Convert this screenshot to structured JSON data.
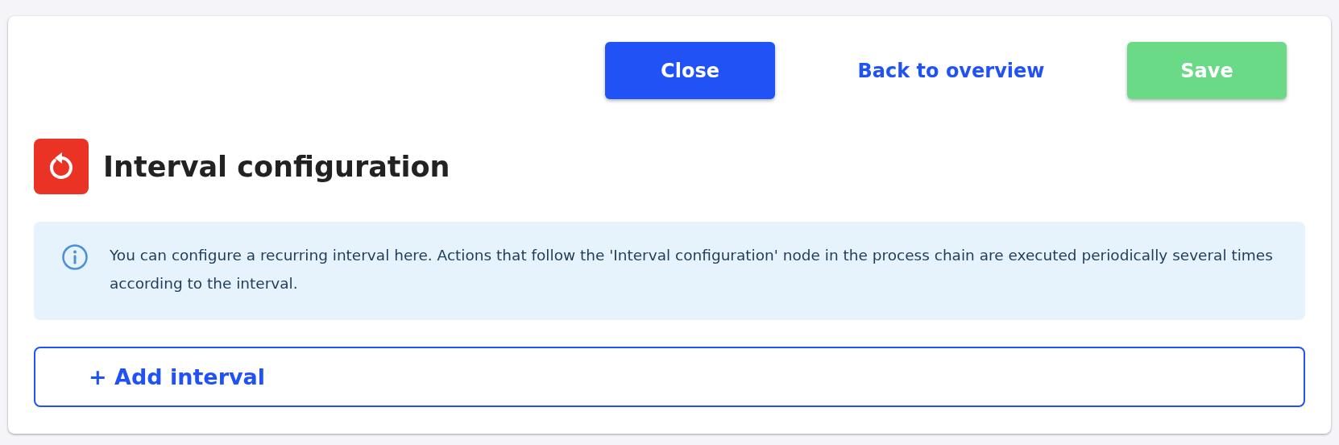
{
  "actions": [
    {
      "label": "Close",
      "kind": "primary"
    },
    {
      "label": "Back to overview",
      "kind": "link"
    },
    {
      "label": "Save",
      "kind": "success"
    }
  ],
  "header": {
    "title": "Interval configuration"
  },
  "info": {
    "text": "You can configure a recurring interval here. Actions that follow the 'Interval configuration' node in the process chain are executed periodically several times according to the interval."
  },
  "add_button": {
    "label": "+ Add interval"
  }
}
